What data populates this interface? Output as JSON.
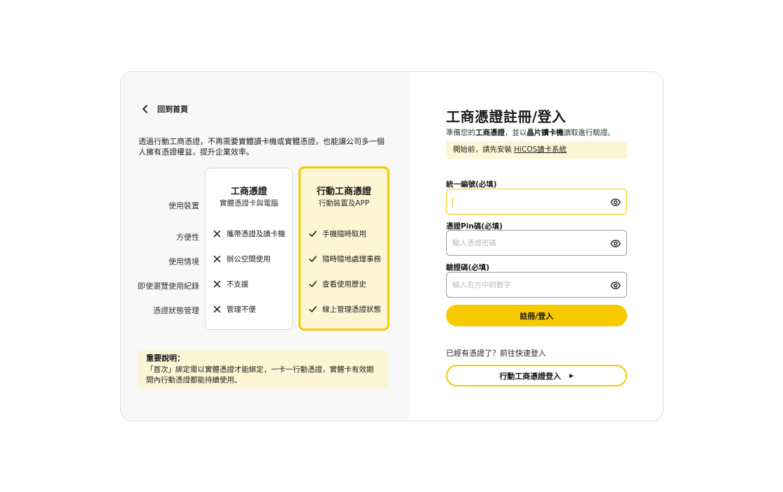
{
  "back": {
    "label": "回到首頁"
  },
  "intro": "透過行動工商憑證，不再需要實體讀卡機或實體憑證，也能讓公司多一個人擁有憑證權益，提升企業效率。",
  "comparison": {
    "row_labels": [
      "使用裝置",
      "方便性",
      "使用情境",
      "即使瀏覽使用紀錄",
      "憑證狀態管理"
    ],
    "standard": {
      "title": "工商憑證",
      "subtitle": "實體憑證卡與電腦",
      "items": [
        "攜帶憑證及讀卡機",
        "辦公空間使用",
        "不支援",
        "管理不便"
      ]
    },
    "mobile": {
      "title": "行動工商憑證",
      "subtitle": "行動裝置及APP",
      "items": [
        "手機隨時取用",
        "隨時隨地處理事務",
        "查看使用歷史",
        "線上管理憑證狀態"
      ]
    }
  },
  "note": {
    "title": "重要說明：",
    "body": "「首次」綁定需以實體憑證才能綁定，一卡一行動憑證，實體卡有效期間內行動憑證都能持續使用。"
  },
  "form": {
    "title": "工商憑證註冊/登入",
    "desc_prefix": "準備您的",
    "desc_bold1": "工商憑證",
    "desc_mid": "，並以",
    "desc_bold2": "晶片讀卡機",
    "desc_suffix": "讀取進行驗證。",
    "notice_prefix": "開始前，請先安裝 ",
    "notice_link": "HiCOS讀卡系統",
    "fields": [
      {
        "label": "統一編號(必填)",
        "value": "",
        "placeholder": ""
      },
      {
        "label": "憑證Pin碼(必填)",
        "value": "",
        "placeholder": "輸入憑證密碼"
      },
      {
        "label": "驗證碼(必填)",
        "value": "",
        "placeholder": "輸入右方中的數字"
      }
    ],
    "submit_label": "註冊/登入",
    "quick_text": "已經有憑證了？前往快速登入",
    "mobile_login_label": "行動工商憑證登入"
  },
  "colors": {
    "accent": "#f5c800",
    "highlight_bg": "#fdf5d4"
  }
}
